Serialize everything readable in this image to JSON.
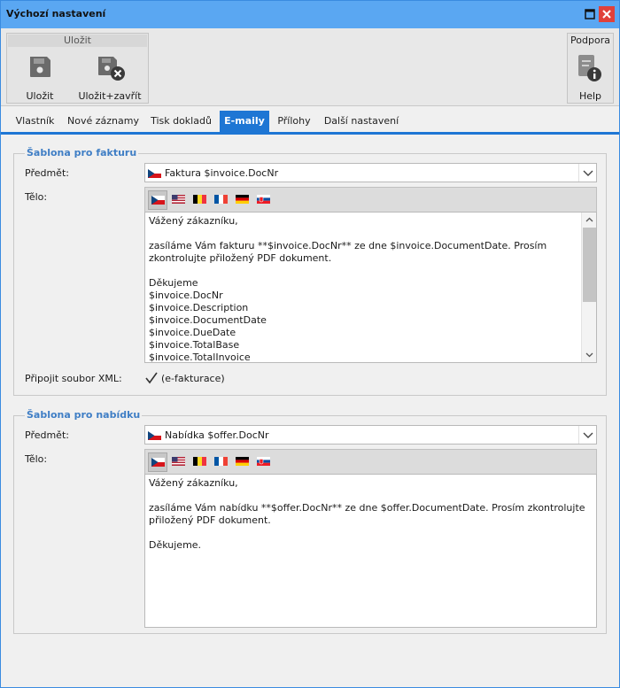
{
  "window": {
    "title": "Výchozí nastavení"
  },
  "ribbon": {
    "group_save_title": "Uložit",
    "save_label": "Uložit",
    "save_close_label": "Uložit+zavřít",
    "group_support_title": "Podpora",
    "help_label": "Help"
  },
  "tabs": [
    "Vlastník",
    "Nové záznamy",
    "Tisk dokladů",
    "E-maily",
    "Přílohy",
    "Další nastavení"
  ],
  "active_tab": "E-maily",
  "invoice": {
    "title": "Šablona pro fakturu",
    "subject_label": "Předmět:",
    "subject_value": "Faktura $invoice.DocNr",
    "body_label": "Tělo:",
    "body_lines": [
      "Vážený zákazníku,",
      "",
      "zasíláme Vám fakturu **$invoice.DocNr** ze dne $invoice.DocumentDate. Prosím",
      "zkontrolujte přiložený PDF dokument.",
      "",
      "Děkujeme",
      "$invoice.DocNr",
      "$invoice.Description",
      "$invoice.DocumentDate",
      "$invoice.DueDate",
      "$invoice.TotalBase",
      "$invoice.TotalInvoice"
    ],
    "xml_label": "Připojit soubor XML:",
    "xml_checkbox_label": "(e-fakturace)",
    "xml_checked": true
  },
  "offer": {
    "title": "Šablona pro nabídku",
    "subject_label": "Předmět:",
    "subject_value": "Nabídka $offer.DocNr",
    "body_label": "Tělo:",
    "body_lines": [
      "Vážený zákazníku,",
      "",
      "zasíláme Vám nabídku **$offer.DocNr** ze dne $offer.DocumentDate. Prosím zkontrolujte",
      "přiložený PDF dokument.",
      "",
      "Děkujeme."
    ]
  },
  "languages": [
    "cs",
    "en-us",
    "be",
    "fr",
    "de",
    "sk"
  ],
  "colors": {
    "titlebar": "#5aa7f2",
    "accent": "#1e76d4",
    "close": "#e0413a",
    "group_title": "#3f7ec5"
  }
}
